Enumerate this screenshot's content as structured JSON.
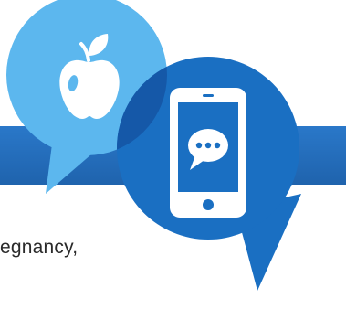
{
  "colors": {
    "band": "#2a78c9",
    "band_dark": "#1f63ad",
    "apple_bubble": "#5cb7ee",
    "phone_bubble": "#1a6fc2",
    "overlap": "#1558a8",
    "icon_fill": "#ffffff",
    "text": "#2a2a2a"
  },
  "icons": {
    "apple": "apple-icon",
    "phone": "smartphone-icon",
    "chat": "chat-bubble-icon"
  },
  "text": {
    "body_fragment": "egnancy,"
  }
}
